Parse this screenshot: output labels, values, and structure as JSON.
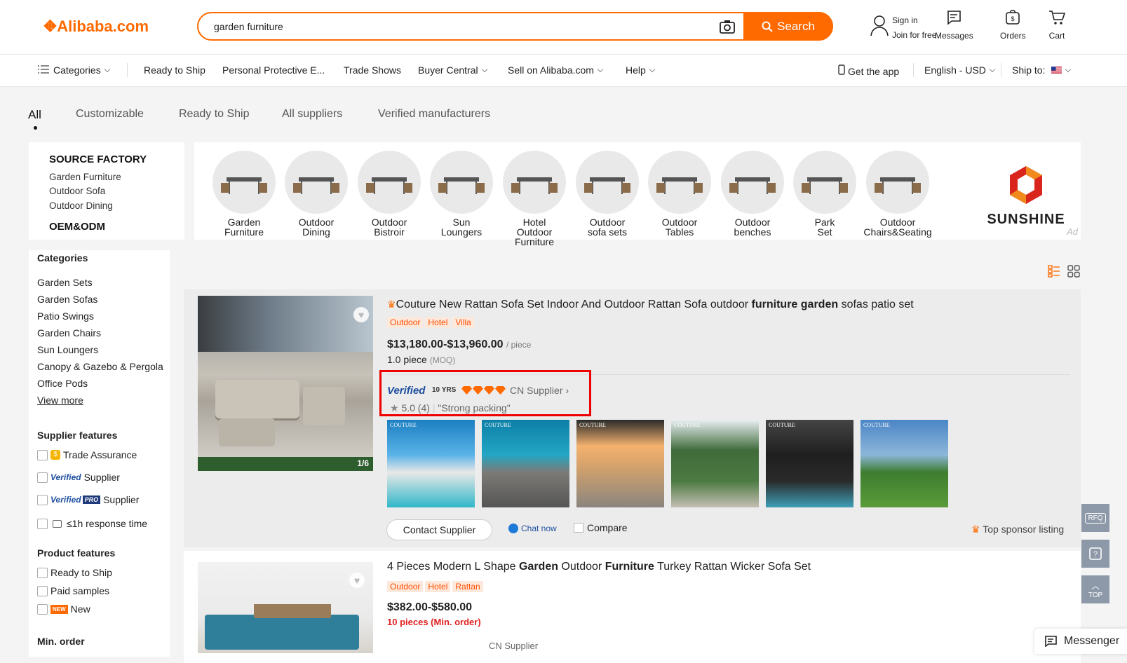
{
  "header": {
    "logo_text": "Alibaba.com",
    "search_value": "garden furniture",
    "search_button": "Search",
    "sign_in": "Sign in",
    "join": "Join for free",
    "messages": "Messages",
    "orders": "Orders",
    "cart": "Cart"
  },
  "nav": {
    "categories": "Categories",
    "items": [
      "Ready to Ship",
      "Personal Protective E...",
      "Trade Shows",
      "Buyer Central",
      "Sell on Alibaba.com",
      "Help"
    ],
    "get_app": "Get the app",
    "language": "English - USD",
    "ship_to": "Ship to:"
  },
  "tabs": [
    "All",
    "Customizable",
    "Ready to Ship",
    "All suppliers",
    "Verified manufacturers"
  ],
  "ad": {
    "source_factory": "SOURCE FACTORY",
    "links": [
      "Garden Furniture",
      "Outdoor Sofa",
      "Outdoor Dining"
    ],
    "oem": "OEM&ODM",
    "categories": [
      [
        "Garden",
        "Furniture"
      ],
      [
        "Outdoor",
        "Dining"
      ],
      [
        "Outdoor",
        "Bistroir"
      ],
      [
        "Sun",
        "Loungers"
      ],
      [
        "Hotel",
        "Outdoor Furniture"
      ],
      [
        "Outdoor",
        "sofa sets"
      ],
      [
        "Outdoor",
        "Tables"
      ],
      [
        "Outdoor",
        "benches"
      ],
      [
        "Park",
        "Set"
      ],
      [
        "Outdoor",
        "Chairs&Seating"
      ]
    ],
    "brand": "SUNSHINE",
    "ad_label": "Ad"
  },
  "sidebar": {
    "categories_title": "Categories",
    "categories": [
      "Garden Sets",
      "Garden Sofas",
      "Patio Swings",
      "Garden Chairs",
      "Sun Loungers",
      "Canopy & Gazebo & Pergola",
      "Office Pods"
    ],
    "view_more": "View more",
    "supplier_title": "Supplier features",
    "trade_assurance": "Trade Assurance",
    "verified_supplier": "Supplier",
    "verified_pro": "Supplier",
    "verified_logo": "Verified",
    "pro_logo": "PRO",
    "response": "≤1h response time",
    "product_title": "Product features",
    "ready": "Ready to Ship",
    "paid": "Paid samples",
    "new": "New",
    "new_badge": "NEW",
    "min_order": "Min. order"
  },
  "product1": {
    "title_pre": "Couture New Rattan Sofa Set Indoor And Outdoor Rattan Sofa outdoor ",
    "title_bold1": "furniture",
    "title_sp": " ",
    "title_bold2": "garden",
    "title_post": " sofas patio set",
    "tags": [
      "Outdoor",
      "Hotel",
      "Villa"
    ],
    "price": "$13,180.00-$13,960.00",
    "price_unit": "/ piece",
    "moq": "1.0 piece",
    "moq_label": "(MOQ)",
    "verified": "Verified",
    "years": "10 YRS",
    "supplier_type": "CN Supplier",
    "rating": "5.0 (4)",
    "review": "\"Strong packing\"",
    "image_counter": "1/6",
    "thumb_brand": "COUTURE",
    "contact": "Contact Supplier",
    "chat": "Chat now",
    "compare": "Compare",
    "sponsor": "Top sponsor listing"
  },
  "product2": {
    "title_pre": "4 Pieces Modern L Shape ",
    "title_bold1": "Garden",
    "title_mid": " Outdoor ",
    "title_bold2": "Furniture",
    "title_post": " Turkey Rattan Wicker Sofa Set",
    "tags": [
      "Outdoor",
      "Hotel",
      "Rattan"
    ],
    "price": "$382.00-$580.00",
    "moq": "10 pieces",
    "moq_label": "(Min. order)",
    "supplier_type": "CN Supplier"
  },
  "floating": {
    "rfq": "RFQ",
    "top": "TOP",
    "messenger": "Messenger"
  },
  "colors": {
    "accent": "#ff6a00",
    "verified": "#1e4fa0",
    "highlight": "#e00000"
  }
}
